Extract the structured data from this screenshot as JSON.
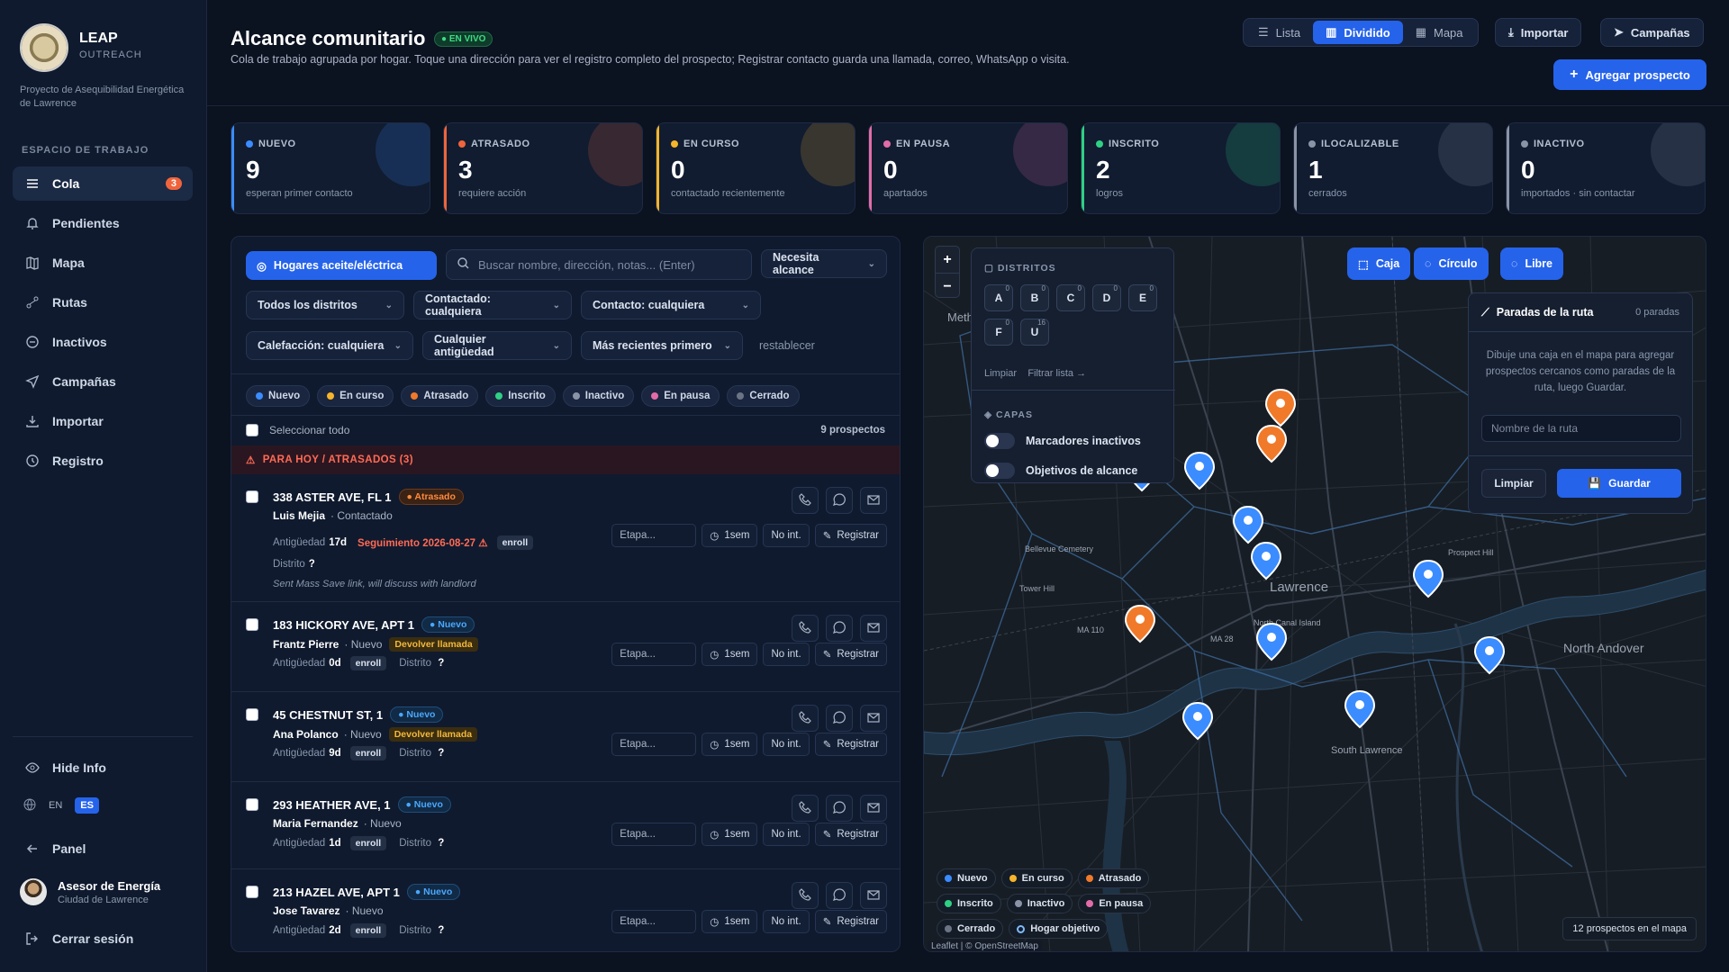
{
  "sidebar": {
    "brand": "LEAP",
    "brand_sub": "OUTREACH",
    "project": "Proyecto de Asequibilidad Energética de Lawrence",
    "section": "ESPACIO DE TRABAJO",
    "items": [
      {
        "label": "Cola",
        "icon": "list-icon",
        "badge": "3"
      },
      {
        "label": "Pendientes",
        "icon": "bell-icon"
      },
      {
        "label": "Mapa",
        "icon": "map-icon"
      },
      {
        "label": "Rutas",
        "icon": "route-icon"
      },
      {
        "label": "Inactivos",
        "icon": "circle-minus-icon"
      },
      {
        "label": "Campañas",
        "icon": "send-icon"
      },
      {
        "label": "Importar",
        "icon": "download-icon"
      },
      {
        "label": "Registro",
        "icon": "clock-icon"
      }
    ],
    "hide_info": "Hide Info",
    "lang_en": "EN",
    "lang_es": "ES",
    "panel": "Panel",
    "user_name": "Asesor de Energía",
    "user_sub": "Ciudad de Lawrence",
    "logout": "Cerrar sesión"
  },
  "header": {
    "title": "Alcance comunitario",
    "live": "EN VIVO",
    "subtitle": "Cola de trabajo agrupada por hogar. Toque una dirección para ver el registro completo del prospecto; Registrar contacto guarda una llamada, correo, WhatsApp o visita.",
    "views": [
      "Lista",
      "Dividido",
      "Mapa"
    ],
    "import": "Importar",
    "campaigns": "Campañas",
    "add": "Agregar prospecto"
  },
  "stats": [
    {
      "label": "NUEVO",
      "value": "9",
      "sub": "esperan primer contacto",
      "color": "#3b8cff"
    },
    {
      "label": "ATRASADO",
      "value": "3",
      "sub": "requiere acción",
      "color": "#f0643c"
    },
    {
      "label": "EN CURSO",
      "value": "0",
      "sub": "contactado recientemente",
      "color": "#f5b42a"
    },
    {
      "label": "EN PAUSA",
      "value": "0",
      "sub": "apartados",
      "color": "#e26ca8"
    },
    {
      "label": "INSCRITO",
      "value": "2",
      "sub": "logros",
      "color": "#2fd084"
    },
    {
      "label": "ILOCALIZABLE",
      "value": "1",
      "sub": "cerrados",
      "color": "#8a94a6"
    },
    {
      "label": "INACTIVO",
      "value": "0",
      "sub": "importados · sin contactar",
      "color": "#8a94a6"
    }
  ],
  "filters": {
    "oil": "Hogares aceite/eléctrica",
    "search_placeholder": "Buscar nombre, dirección, notas... (Enter)",
    "need": "Necesita alcance",
    "districts": "Todos los distritos",
    "contacted": "Contactado: cualquiera",
    "contact": "Contacto: cualquiera",
    "heating": "Calefacción: cualquiera",
    "age": "Cualquier antigüedad",
    "sort": "Más recientes primero",
    "reset": "restablecer"
  },
  "chips": [
    {
      "label": "Nuevo",
      "color": "#3b8cff"
    },
    {
      "label": "En curso",
      "color": "#f5b42a"
    },
    {
      "label": "Atrasado",
      "color": "#f07a2a"
    },
    {
      "label": "Inscrito",
      "color": "#2fd084"
    },
    {
      "label": "Inactivo",
      "color": "#8a94a6"
    },
    {
      "label": "En pausa",
      "color": "#e26ca8"
    },
    {
      "label": "Cerrado",
      "color": "#6b7485"
    }
  ],
  "list": {
    "select_all": "Seleccionar todo",
    "count": "9 prospectos",
    "today": "PARA HOY / ATRASADOS (3)",
    "etapa": "Etapa...",
    "week": "1sem",
    "noint": "No int.",
    "register": "Registrar",
    "age_label": "Antigüedad",
    "district_label": "Distrito",
    "enroll": "enroll",
    "rows": [
      {
        "address": "338 ASTER AVE, FL 1",
        "status": "Atrasado",
        "name": "Luis Mejia",
        "state": "Contactado",
        "age": "17d",
        "followup": "Seguimiento 2026-08-27",
        "district": "?",
        "note": "Sent Mass Save link, will discuss with landlord"
      },
      {
        "address": "183 HICKORY AVE, APT 1",
        "status": "Nuevo",
        "name": "Frantz Pierre",
        "state": "Nuevo",
        "tag": "Devolver llamada",
        "age": "0d",
        "district": "?"
      },
      {
        "address": "45 CHESTNUT ST, 1",
        "status": "Nuevo",
        "name": "Ana Polanco",
        "state": "Nuevo",
        "tag": "Devolver llamada",
        "age": "9d",
        "district": "?"
      },
      {
        "address": "293 HEATHER AVE, 1",
        "status": "Nuevo",
        "name": "Maria Fernandez",
        "state": "Nuevo",
        "age": "1d",
        "district": "?"
      },
      {
        "address": "213 HAZEL AVE, APT 1",
        "status": "Nuevo",
        "name": "Jose Tavarez",
        "state": "Nuevo",
        "age": "2d",
        "district": "?"
      }
    ]
  },
  "map": {
    "districts_title": "DISTRITOS",
    "districts": [
      {
        "k": "A",
        "n": "0"
      },
      {
        "k": "B",
        "n": "0"
      },
      {
        "k": "C",
        "n": "0"
      },
      {
        "k": "D",
        "n": "0"
      },
      {
        "k": "E",
        "n": "0"
      },
      {
        "k": "F",
        "n": "0"
      },
      {
        "k": "U",
        "n": "16"
      }
    ],
    "clear": "Limpiar",
    "filter_list": "Filtrar lista →",
    "layers_title": "CAPAS",
    "layer1": "Marcadores inactivos",
    "layer2": "Objetivos de alcance",
    "tools": [
      "Caja",
      "Círculo",
      "Libre"
    ],
    "route_title": "Paradas de la ruta",
    "route_count": "0 paradas",
    "route_desc": "Dibuje una caja en el mapa para agregar prospectos cercanos como paradas de la ruta, luego Guardar.",
    "route_placeholder": "Nombre de la ruta",
    "route_clear": "Limpiar",
    "route_save": "Guardar",
    "legend": [
      {
        "label": "Nuevo",
        "color": "#3b8cff"
      },
      {
        "label": "En curso",
        "color": "#f5b42a"
      },
      {
        "label": "Atrasado",
        "color": "#f07a2a"
      },
      {
        "label": "Inscrito",
        "color": "#2fd084"
      },
      {
        "label": "Inactivo",
        "color": "#8a94a6"
      },
      {
        "label": "En pausa",
        "color": "#e26ca8"
      },
      {
        "label": "Cerrado",
        "color": "#6b7485"
      }
    ],
    "target": "Hogar objetivo",
    "count": "12 prospectos en el mapa",
    "attribution": "Leaflet | © OpenStreetMap",
    "labels": [
      "Lawrence",
      "North Andover",
      "South Lawrence",
      "Methuen",
      "Bellevue Cemetery",
      "Prospect Hill",
      "Tower Hill",
      "North Canal Island",
      "MA 110",
      "MA 28"
    ]
  }
}
